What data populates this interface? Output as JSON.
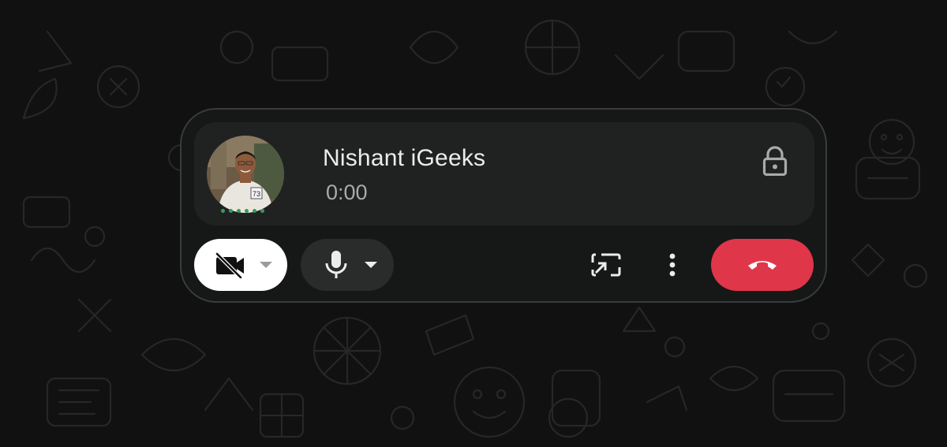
{
  "call": {
    "caller_name": "Nishant iGeeks",
    "duration": "0:00",
    "end_to_end_encrypted_icon": "lock-icon"
  },
  "controls": {
    "video": {
      "icon": "video-off-icon",
      "state": "off",
      "dropdown_icon": "caret-down-icon"
    },
    "microphone": {
      "icon": "microphone-icon",
      "state": "on",
      "dropdown_icon": "caret-down-icon"
    },
    "screen_share": {
      "icon": "screen-share-icon"
    },
    "more": {
      "icon": "more-vertical-icon"
    },
    "end_call": {
      "icon": "end-call-icon"
    }
  },
  "colors": {
    "end_call": "#e0364a",
    "video_button": "#ffffff",
    "panel": "#202222",
    "window": "#161717",
    "presence_dots": "#3b9a5a"
  }
}
